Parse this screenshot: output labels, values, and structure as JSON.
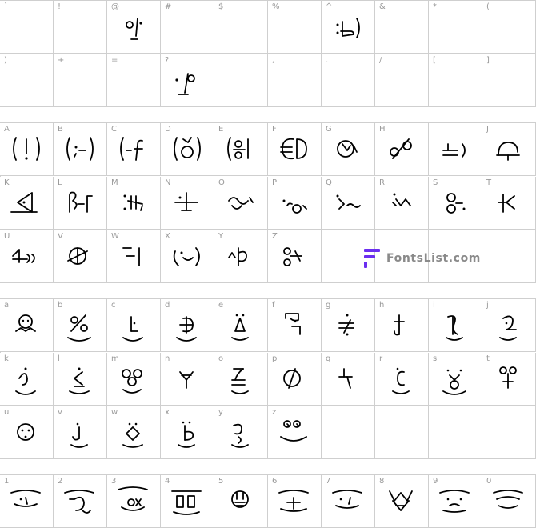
{
  "rows": [
    {
      "labels": [
        "`",
        "!",
        "@",
        "#",
        "$",
        "%",
        "^",
        "&",
        "*",
        "("
      ],
      "glyphs": [
        "",
        "",
        "at",
        "",
        "",
        "",
        "caret",
        "",
        "",
        ""
      ]
    },
    {
      "labels": [
        ")",
        "+",
        "=",
        "?",
        "",
        ",",
        ".",
        "/",
        "[",
        "]"
      ],
      "glyphs": [
        "",
        "",
        "",
        "question",
        "",
        "",
        "",
        "",
        "",
        ""
      ]
    },
    {
      "labels": [
        "A",
        "B",
        "C",
        "D",
        "E",
        "F",
        "G",
        "H",
        "I",
        "J"
      ],
      "glyphs": [
        "A",
        "B",
        "C",
        "D",
        "E",
        "F",
        "G",
        "H",
        "I",
        "J"
      ]
    },
    {
      "labels": [
        "K",
        "L",
        "M",
        "N",
        "O",
        "P",
        "Q",
        "R",
        "S",
        "T"
      ],
      "glyphs": [
        "K",
        "L",
        "M",
        "N",
        "O",
        "P",
        "Q",
        "R",
        "S",
        "T"
      ]
    },
    {
      "labels": [
        "U",
        "V",
        "W",
        "X",
        "Y",
        "Z",
        "",
        "",
        "",
        ""
      ],
      "glyphs": [
        "U",
        "V",
        "W",
        "X",
        "Y",
        "Z",
        "",
        "",
        "",
        ""
      ]
    },
    {
      "labels": [
        "a",
        "b",
        "c",
        "d",
        "e",
        "f",
        "g",
        "h",
        "i",
        "j"
      ],
      "glyphs": [
        "a",
        "b",
        "c",
        "d",
        "e",
        "f",
        "g",
        "h",
        "i",
        "j"
      ]
    },
    {
      "labels": [
        "k",
        "l",
        "m",
        "n",
        "o",
        "p",
        "q",
        "r",
        "s",
        "t"
      ],
      "glyphs": [
        "k",
        "l",
        "m",
        "n",
        "o",
        "p",
        "q",
        "r",
        "s",
        "t"
      ]
    },
    {
      "labels": [
        "u",
        "v",
        "w",
        "x",
        "y",
        "z",
        "",
        "",
        "",
        ""
      ],
      "glyphs": [
        "u",
        "v",
        "w",
        "x",
        "y",
        "z",
        "",
        "",
        "",
        ""
      ]
    },
    {
      "labels": [
        "1",
        "2",
        "3",
        "4",
        "5",
        "6",
        "7",
        "8",
        "9",
        "0"
      ],
      "glyphs": [
        "n1",
        "n2",
        "n3",
        "n4",
        "n5",
        "n6",
        "n7",
        "n8",
        "n9",
        "n0"
      ]
    }
  ],
  "watermark": {
    "text": "FontsList.com",
    "brand_color": "#6b2ef0"
  },
  "colors": {
    "grid_line": "#cfcfcf",
    "label": "#9a9a9a",
    "glyph": "#000000"
  }
}
